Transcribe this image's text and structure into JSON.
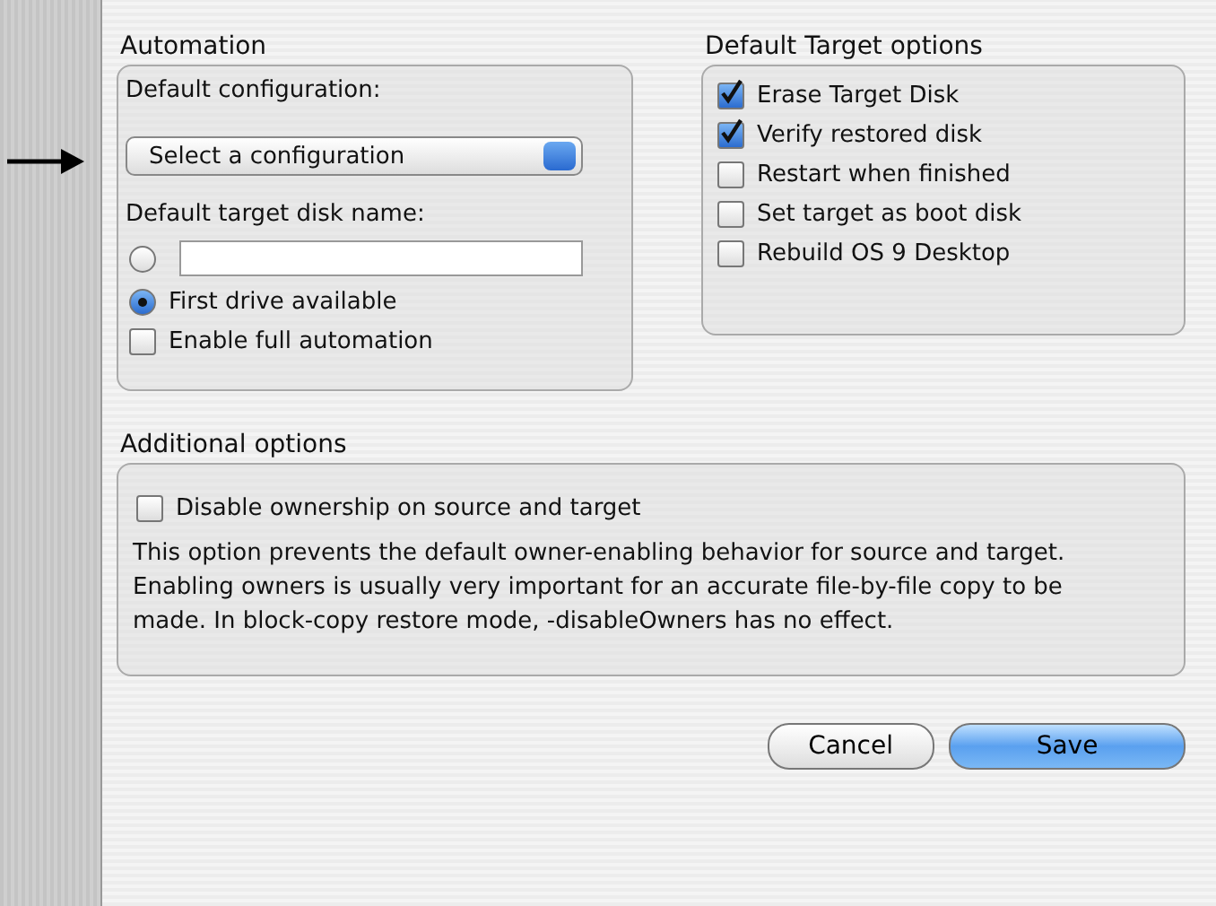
{
  "automation": {
    "title": "Automation",
    "config_label": "Default configuration:",
    "config_select": "Select a configuration",
    "disk_name_label": "Default target disk name:",
    "disk_options": [
      {
        "kind": "field",
        "selected": false
      },
      {
        "kind": "label",
        "selected": true,
        "label": "First drive available"
      }
    ],
    "full_automation": {
      "label": "Enable full automation",
      "checked": false
    }
  },
  "target_options": {
    "title": "Default Target options",
    "items": [
      {
        "label": "Erase Target Disk",
        "checked": true
      },
      {
        "label": "Verify restored disk",
        "checked": true
      },
      {
        "label": "Restart when finished",
        "checked": false
      },
      {
        "label": "Set target as boot disk",
        "checked": false
      },
      {
        "label": "Rebuild OS 9 Desktop",
        "checked": false
      }
    ]
  },
  "additional": {
    "title": "Additional options",
    "checkbox": {
      "label": "Disable ownership on source and target",
      "checked": false
    },
    "description": "This option prevents the default owner-enabling behavior for source and target.  Enabling owners is usually very important for an accurate file-by-file copy to be made.  In block-copy restore mode, -disableOwners has no effect."
  },
  "buttons": [
    {
      "label": "Cancel",
      "default": false
    },
    {
      "label": "Save",
      "default": true
    }
  ]
}
